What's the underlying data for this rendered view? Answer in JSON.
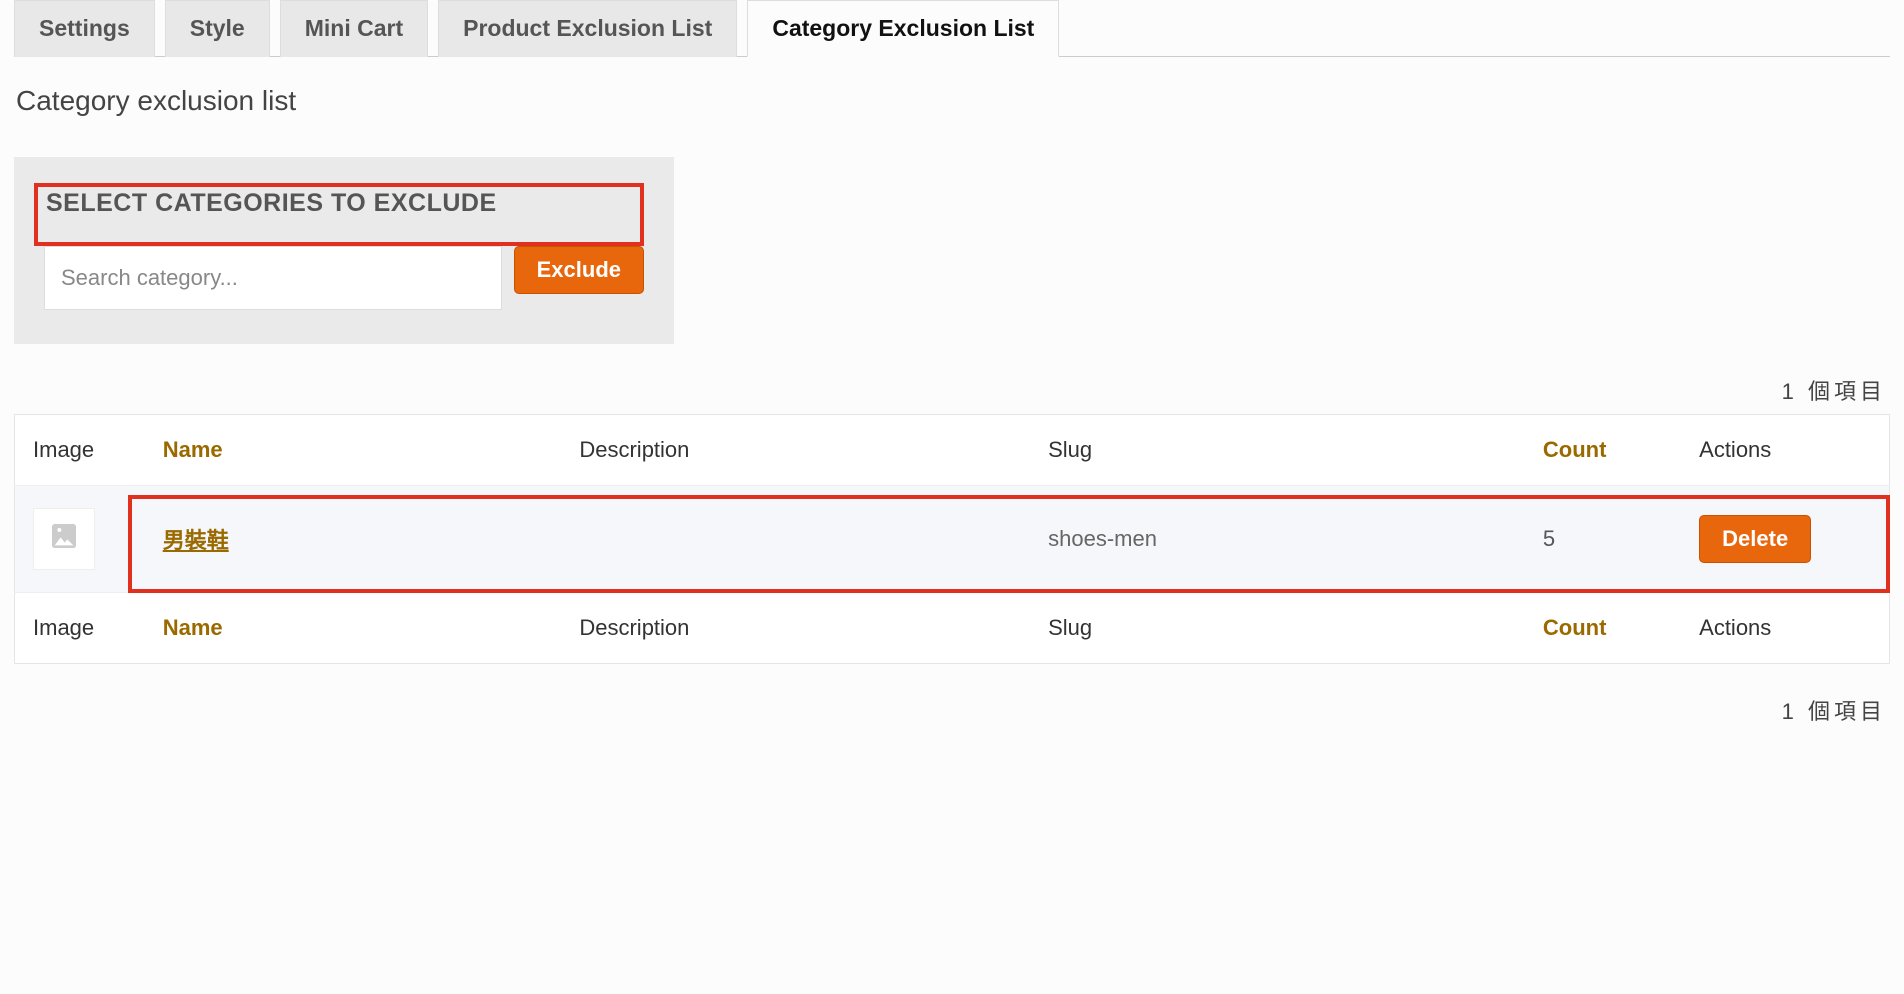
{
  "tabs": [
    {
      "label": "Settings"
    },
    {
      "label": "Style"
    },
    {
      "label": "Mini Cart"
    },
    {
      "label": "Product Exclusion List"
    },
    {
      "label": "Category Exclusion List",
      "active": true
    }
  ],
  "page_title": "Category exclusion list",
  "panel": {
    "heading": "SELECT CATEGORIES TO EXCLUDE",
    "search_placeholder": "Search category...",
    "exclude_button": "Exclude"
  },
  "item_count": "1 個項目",
  "columns": {
    "image": "Image",
    "name": "Name",
    "description": "Description",
    "slug": "Slug",
    "count": "Count",
    "actions": "Actions"
  },
  "rows": [
    {
      "name": "男裝鞋",
      "description": "",
      "slug": "shoes-men",
      "count": "5",
      "delete_label": "Delete"
    }
  ]
}
